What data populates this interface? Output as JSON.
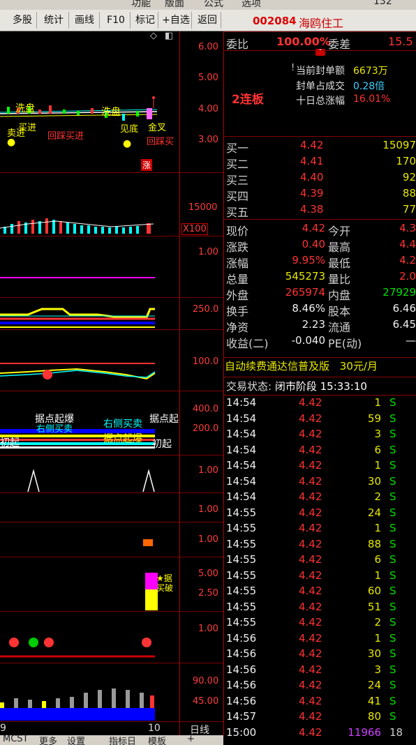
{
  "topbar": {
    "items": [
      "功能",
      "版面",
      "公式",
      "选项",
      "132"
    ]
  },
  "toolbar": {
    "buttons": [
      "多股",
      "统计",
      "画线",
      "F10",
      "标记",
      "+自选",
      "返回"
    ]
  },
  "stock": {
    "code": "002084",
    "name": "海鸥住工"
  },
  "order_ratio": {
    "label1": "委比",
    "value1": "100.00%",
    "label2": "委差",
    "value2": "15.5"
  },
  "board": {
    "label": "2连板",
    "seal_amount_label": "当前封单额",
    "seal_amount": "6673万",
    "seal_ratio_label": "封单占成交",
    "seal_ratio": "0.28倍",
    "ten_day_label": "十日总涨幅",
    "ten_day": "16.01%"
  },
  "bids": [
    {
      "label": "买一",
      "price": "4.42",
      "vol": "15097"
    },
    {
      "label": "买二",
      "price": "4.41",
      "vol": "170"
    },
    {
      "label": "买三",
      "price": "4.40",
      "vol": "92"
    },
    {
      "label": "买四",
      "price": "4.39",
      "vol": "88"
    },
    {
      "label": "买五",
      "price": "4.38",
      "vol": "77"
    }
  ],
  "quote": [
    {
      "l1": "现价",
      "v1": "4.42",
      "l2": "今开",
      "v2": "4.3"
    },
    {
      "l1": "涨跌",
      "v1": "0.40",
      "l2": "最高",
      "v2": "4.4"
    },
    {
      "l1": "涨幅",
      "v1": "9.95%",
      "l2": "最低",
      "v2": "4.2"
    },
    {
      "l1": "总量",
      "v1": "545273",
      "l2": "量比",
      "v2": "2.0"
    },
    {
      "l1": "外盘",
      "v1": "265974",
      "l2": "内盘",
      "v2": "27929"
    },
    {
      "l1": "换手",
      "v1": "8.46%",
      "l2": "股本",
      "v2": "6.46"
    },
    {
      "l1": "净资",
      "v1": "2.23",
      "l2": "流通",
      "v2": "6.45"
    },
    {
      "l1": "收益(二)",
      "v1": "-0.040",
      "l2": "PE(动)",
      "v2": "—"
    }
  ],
  "ad": {
    "text": "自动续费通达信普及版",
    "price": "30元/月"
  },
  "trade_status": {
    "label": "交易状态:",
    "value": "闭市阶段 15:33:10"
  },
  "ticks": [
    {
      "t": "14:54",
      "p": "4.42",
      "v": "1",
      "s": "S"
    },
    {
      "t": "14:54",
      "p": "4.42",
      "v": "59",
      "s": "S"
    },
    {
      "t": "14:54",
      "p": "4.42",
      "v": "3",
      "s": "S"
    },
    {
      "t": "14:54",
      "p": "4.42",
      "v": "6",
      "s": "S"
    },
    {
      "t": "14:54",
      "p": "4.42",
      "v": "1",
      "s": "S"
    },
    {
      "t": "14:54",
      "p": "4.42",
      "v": "30",
      "s": "S"
    },
    {
      "t": "14:54",
      "p": "4.42",
      "v": "2",
      "s": "S"
    },
    {
      "t": "14:55",
      "p": "4.42",
      "v": "24",
      "s": "S"
    },
    {
      "t": "14:55",
      "p": "4.42",
      "v": "1",
      "s": "S"
    },
    {
      "t": "14:55",
      "p": "4.42",
      "v": "88",
      "s": "S"
    },
    {
      "t": "14:55",
      "p": "4.42",
      "v": "6",
      "s": "S"
    },
    {
      "t": "14:55",
      "p": "4.42",
      "v": "1",
      "s": "S"
    },
    {
      "t": "14:55",
      "p": "4.42",
      "v": "60",
      "s": "S"
    },
    {
      "t": "14:55",
      "p": "4.42",
      "v": "51",
      "s": "S"
    },
    {
      "t": "14:55",
      "p": "4.42",
      "v": "2",
      "s": "S"
    },
    {
      "t": "14:56",
      "p": "4.42",
      "v": "1",
      "s": "S"
    },
    {
      "t": "14:56",
      "p": "4.42",
      "v": "30",
      "s": "S"
    },
    {
      "t": "14:56",
      "p": "4.42",
      "v": "3",
      "s": "S"
    },
    {
      "t": "14:56",
      "p": "4.42",
      "v": "24",
      "s": "S"
    },
    {
      "t": "14:56",
      "p": "4.42",
      "v": "41",
      "s": "S"
    },
    {
      "t": "14:57",
      "p": "4.42",
      "v": "80",
      "s": "S"
    },
    {
      "t": "15:00",
      "p": "4.42",
      "v": "11966",
      "s": "18"
    }
  ],
  "chart_axes": {
    "main": [
      "6.00",
      "5.00",
      "4.00",
      "3.00"
    ],
    "vol": [
      "15000",
      "X100"
    ],
    "p3": [
      "1.00"
    ],
    "p4": [
      "250.0"
    ],
    "p5": [
      "100.0"
    ],
    "p6": [
      "400.0",
      "200.0"
    ],
    "p7": [
      "1.00"
    ],
    "p8": [
      "1.00"
    ],
    "p9": [
      "1.00"
    ],
    "p10": [
      "5.00",
      "2.50"
    ],
    "p11": [
      "1.00"
    ],
    "p12": [
      "90.00",
      "45.00"
    ]
  },
  "chart_labels": {
    "main": [
      "洗盘",
      "洗盘",
      "卖进",
      "买进",
      "回踩买进",
      "见底",
      "金叉",
      "回踩买",
      "涨"
    ],
    "p6": [
      "据点起爆",
      "右侧买卖",
      "右侧买卖",
      "据点起爆",
      "据点起",
      "初起",
      "初起"
    ],
    "p10": [
      "★据",
      "买破"
    ]
  },
  "bottom": {
    "items": [
      "MCST",
      "更多",
      "设置",
      "指标日",
      "模板",
      "+",
      "日线"
    ],
    "date_left": "9",
    "date_right": "10"
  },
  "colors": {
    "up": "#ff3232",
    "down": "#00e000",
    "accent": "#e8e800",
    "bg": "#000000"
  }
}
